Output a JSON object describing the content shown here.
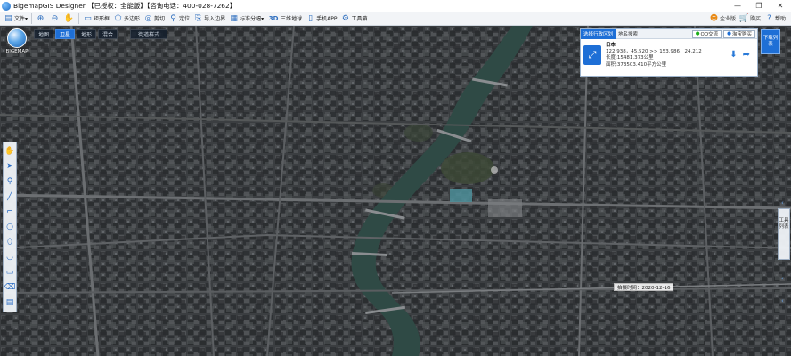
{
  "window": {
    "title": "BigemapGIS Designer 【已授权：全能版】【咨询电话：400-028-7262】",
    "minimize": "—",
    "maximize": "❐",
    "close": "✕"
  },
  "toolbar": {
    "items": [
      {
        "icon": "file-icon",
        "label": "文件▾"
      },
      {
        "icon": "zoom-in-icon",
        "label": ""
      },
      {
        "icon": "zoom-out-icon",
        "label": ""
      },
      {
        "icon": "hand-icon",
        "label": ""
      },
      {
        "icon": "rectangle-icon",
        "label": "矩形框"
      },
      {
        "icon": "polygon-icon",
        "label": "多边形"
      },
      {
        "icon": "circle-icon",
        "label": "剪切"
      },
      {
        "icon": "location-icon",
        "label": "定位"
      },
      {
        "icon": "import-boundary-icon",
        "label": "导入边界"
      },
      {
        "icon": "grid-icon",
        "label": "标准分幅▾"
      },
      {
        "icon": "3d-icon",
        "label": "三维地球"
      },
      {
        "icon": "phone-icon",
        "label": "手机APP"
      },
      {
        "icon": "tools-icon",
        "label": "工具箱"
      }
    ],
    "right": [
      {
        "icon": "user-icon",
        "label": "企业版"
      },
      {
        "icon": "cart-icon",
        "label": "购买"
      },
      {
        "icon": "help-icon",
        "label": "帮助"
      }
    ]
  },
  "map": {
    "logo_label": "BIGEMAP",
    "types": [
      "地图",
      "卫星",
      "地形",
      "混合"
    ],
    "active_type": "卫星",
    "street_style": "街道样式",
    "capture_date": "拍摄时间：2020-12-16"
  },
  "panel": {
    "tabs": [
      "选择行政区划",
      "地名搜索"
    ],
    "active_tab": "选择行政区划",
    "buttons": [
      "QQ交流",
      "淘宝购买"
    ],
    "region_name": "日本",
    "coords": "122.938，45.520 >> 153.986，24.212",
    "perimeter": "长度:15481.373公里",
    "area": "面积:373503.410平方公里"
  },
  "right": {
    "task_button": "下载列表",
    "side_panel": "工具列表"
  },
  "colors": {
    "accent": "#1e6fd6",
    "river": "#2f4a45",
    "urban": "#3a3d40"
  }
}
